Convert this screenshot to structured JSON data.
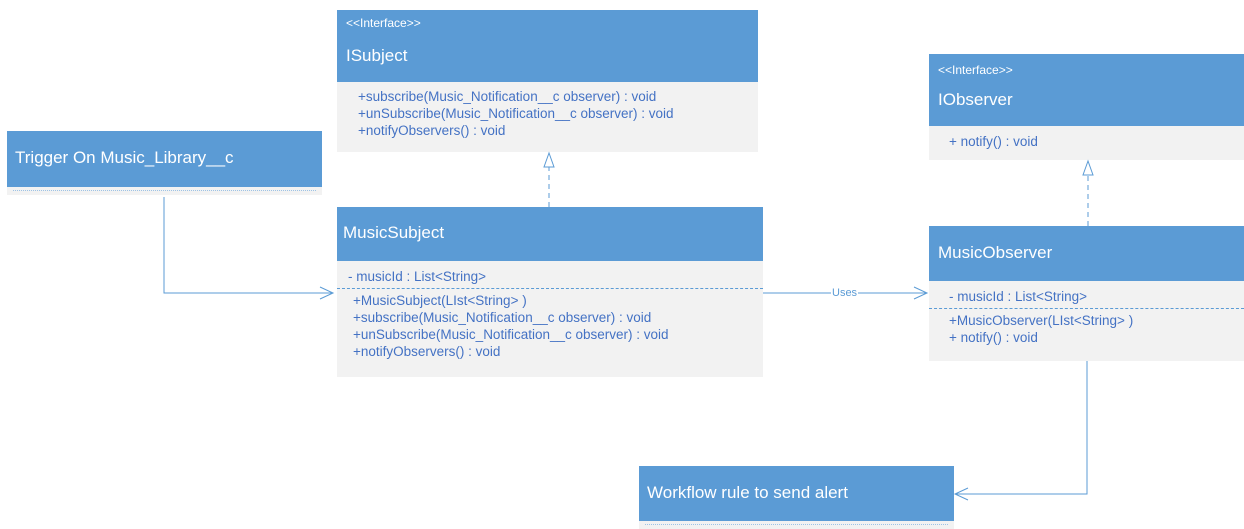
{
  "isubject": {
    "stereotype": "<<Interface>>",
    "name": "ISubject",
    "methods": [
      "+subscribe(Music_Notification__c observer) : void",
      "+unSubscribe(Music_Notification__c observer) : void",
      "+notifyObservers() : void"
    ]
  },
  "iobserver": {
    "stereotype": "<<Interface>>",
    "name": "IObserver",
    "methods": [
      "+ notify() : void"
    ]
  },
  "trigger": {
    "name": "Trigger On Music_Library__c"
  },
  "music_subject": {
    "name": "MusicSubject",
    "attributes": [
      "- musicId : List<String>"
    ],
    "methods": [
      "+MusicSubject(LIst<String> )",
      "+subscribe(Music_Notification__c observer) : void",
      "+unSubscribe(Music_Notification__c observer) : void",
      "+notifyObservers() : void"
    ]
  },
  "music_observer": {
    "name": "MusicObserver",
    "attributes": [
      "- musicId : List<String>"
    ],
    "methods": [
      "+MusicObserver(LIst<String> )",
      "+ notify() : void"
    ]
  },
  "workflow": {
    "name": "Workflow rule to send alert"
  },
  "edges": {
    "uses_label": "Uses"
  },
  "colors": {
    "header": "#5b9bd5",
    "body": "#f2f2f2",
    "text": "#4472c4",
    "connector": "#5b9bd5"
  }
}
